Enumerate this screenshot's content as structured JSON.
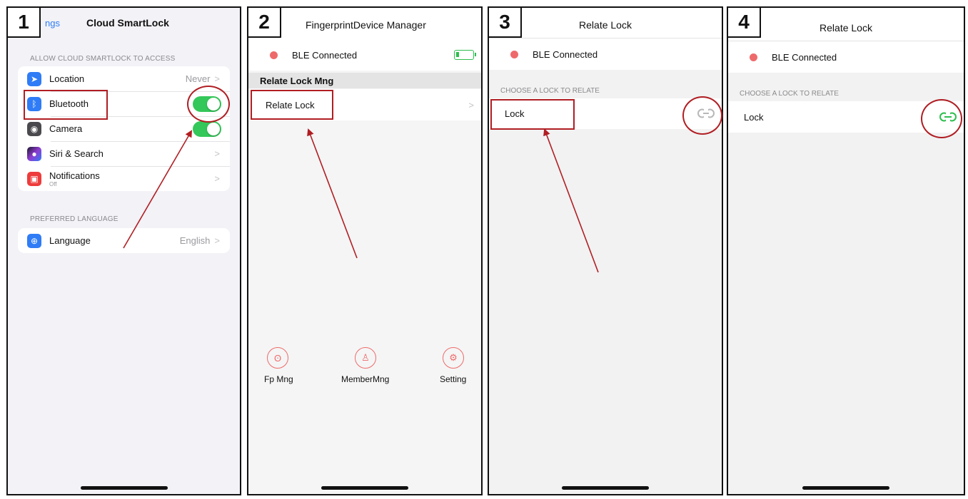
{
  "steps": [
    "1",
    "2",
    "3",
    "4"
  ],
  "panel1": {
    "back_label": "ngs",
    "title": "Cloud SmartLock",
    "section_access": "ALLOW CLOUD SMARTLOCK TO ACCESS",
    "items": [
      {
        "label": "Location",
        "value": "Never"
      },
      {
        "label": "Bluetooth",
        "toggle": "on"
      },
      {
        "label": "Camera",
        "toggle": "on"
      },
      {
        "label": "Siri & Search"
      },
      {
        "label": "Notifications",
        "sub": "Off"
      }
    ],
    "section_language": "PREFERRED LANGUAGE",
    "language": {
      "label": "Language",
      "value": "English"
    }
  },
  "panel2": {
    "title": "FingerprintDevice Manager",
    "ble_status": "BLE Connected",
    "section": "Relate Lock Mng",
    "relate_lock": "Relate Lock",
    "bottom": [
      {
        "label": "Fp Mng",
        "icon": "fingerprint-icon"
      },
      {
        "label": "MemberMng",
        "icon": "member-icon"
      },
      {
        "label": "Setting",
        "icon": "gear-icon"
      }
    ]
  },
  "panel3": {
    "title": "Relate Lock",
    "ble_status": "BLE Connected",
    "section": "CHOOSE A LOCK TO RELATE",
    "lock_label": "Lock",
    "link_state": "unlinked"
  },
  "panel4": {
    "title": "Relate Lock",
    "ble_status": "BLE Connected",
    "section": "CHOOSE A LOCK TO RELATE",
    "lock_label": "Lock",
    "link_state": "linked"
  },
  "colors": {
    "ios_blue": "#2f7cf6",
    "toggle_green": "#34c759",
    "status_red": "#ee6a6a",
    "annotation_red": "#b01e23",
    "link_gray": "#b8b8b8",
    "link_green": "#2dbe4e"
  }
}
